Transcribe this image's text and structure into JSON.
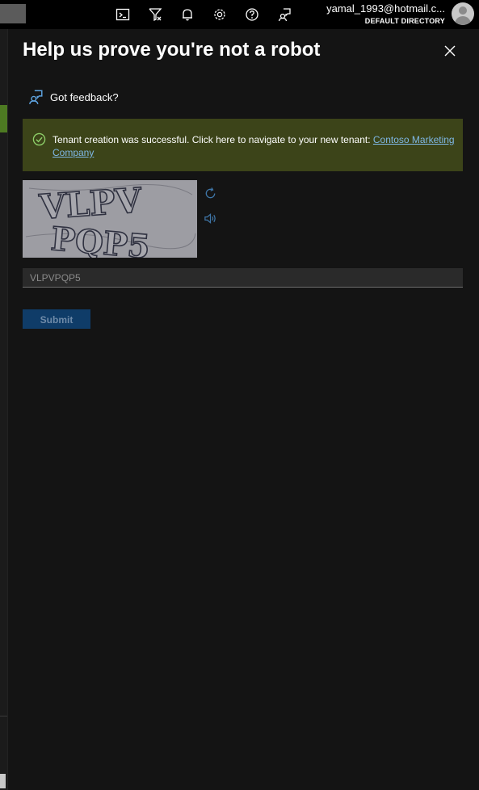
{
  "topbar": {
    "icons": [
      "cloud-shell-icon",
      "directory-filter-icon",
      "notifications-icon",
      "settings-icon",
      "help-icon",
      "feedback-icon"
    ],
    "account": {
      "email": "yamal_1993@hotmail.c...",
      "directory": "DEFAULT DIRECTORY"
    }
  },
  "panel": {
    "title": "Help us prove you're not a robot",
    "feedback_label": "Got feedback?",
    "banner": {
      "text": "Tenant creation was successful. Click here to navigate to your new tenant: ",
      "link_text": "Contoso Marketing Company",
      "color": "#3c4419"
    },
    "captcha": {
      "image_text": "VLPV PQP5",
      "refresh_icon": "refresh-icon",
      "audio_icon": "speaker-icon"
    },
    "input": {
      "value": "",
      "placeholder": "VLPVPQP5"
    },
    "submit_label": "Submit"
  },
  "colors": {
    "accent_link": "#7fb8e6",
    "success_icon": "#8fd16a",
    "submit_bg": "#0f3c68"
  }
}
